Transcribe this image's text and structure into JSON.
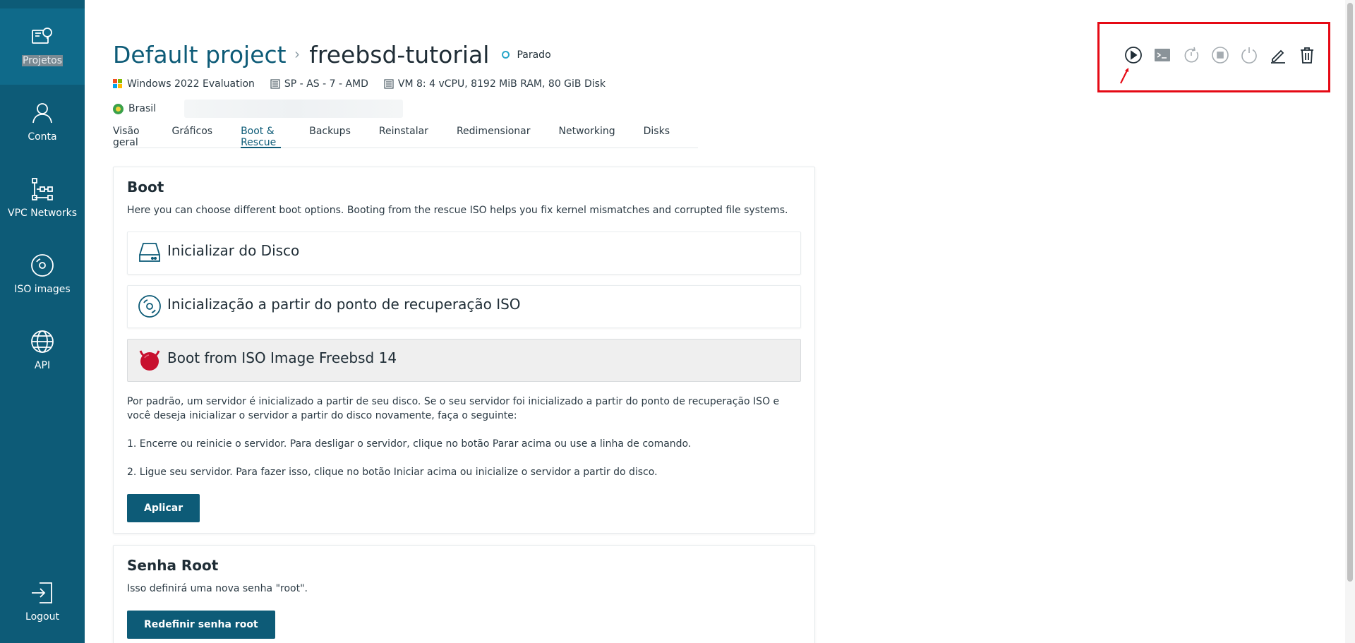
{
  "sidebar": {
    "items": [
      {
        "label": "Projetos",
        "icon": "projects-icon",
        "active": true
      },
      {
        "label": "Conta",
        "icon": "user-icon"
      },
      {
        "label": "VPC Networks",
        "icon": "network-icon"
      },
      {
        "label": "ISO images",
        "icon": "disc-icon"
      },
      {
        "label": "API",
        "icon": "globe-icon"
      }
    ],
    "logout": {
      "label": "Logout",
      "icon": "logout-icon"
    }
  },
  "header": {
    "project": "Default project",
    "separator": "›",
    "vm_name": "freebsd-tutorial",
    "status": "Parado",
    "os": "Windows 2022 Evaluation",
    "location": "SP - AS - 7 - AMD",
    "specs": "VM 8: 4 vCPU, 8192 MiB RAM, 80 GiB Disk",
    "country": "Brasil"
  },
  "tabs": [
    {
      "label": "Visão geral"
    },
    {
      "label": "Gráficos"
    },
    {
      "label": "Boot & Rescue",
      "active": true
    },
    {
      "label": "Backups"
    },
    {
      "label": "Reinstalar"
    },
    {
      "label": "Redimensionar"
    },
    {
      "label": "Networking"
    },
    {
      "label": "Disks"
    }
  ],
  "actions": [
    {
      "name": "start",
      "icon": "play-circle-icon"
    },
    {
      "name": "console",
      "icon": "terminal-icon"
    },
    {
      "name": "reboot",
      "icon": "reboot-icon"
    },
    {
      "name": "stop",
      "icon": "stop-circle-icon"
    },
    {
      "name": "power",
      "icon": "power-icon"
    },
    {
      "name": "edit",
      "icon": "pencil-icon"
    },
    {
      "name": "delete",
      "icon": "trash-icon"
    }
  ],
  "boot": {
    "title": "Boot",
    "description": "Here you can choose different boot options. Booting from the rescue ISO helps you fix kernel mismatches and corrupted file systems.",
    "options": [
      {
        "label": "Inicializar do Disco",
        "icon": "hard-drive-icon"
      },
      {
        "label": "Inicialização a partir do ponto de recuperação ISO",
        "icon": "rescue-disc-icon"
      },
      {
        "label": "Boot from ISO Image Freebsd 14",
        "icon": "freebsd-icon",
        "selected": true
      }
    ],
    "paragraph1": "Por padrão, um servidor é inicializado a partir de seu disco. Se o seu servidor foi inicializado a partir do ponto de recuperação ISO e você deseja inicializar o servidor a partir do disco novamente, faça o seguinte:",
    "step1": "1. Encerre ou reinicie o servidor. Para desligar o servidor, clique no botão Parar acima ou use a linha de comando.",
    "step2": "2. Ligue seu servidor. Para fazer isso, clique no botão Iniciar acima ou inicialize o servidor a partir do disco.",
    "apply_label": "Aplicar"
  },
  "root_password": {
    "title": "Senha Root",
    "description": "Isso definirá uma nova senha \"root\".",
    "reset_label": "Redefinir senha root"
  },
  "colors": {
    "primary": "#0d5b77",
    "status": "#2aa7c9",
    "highlight": "#e50914"
  }
}
